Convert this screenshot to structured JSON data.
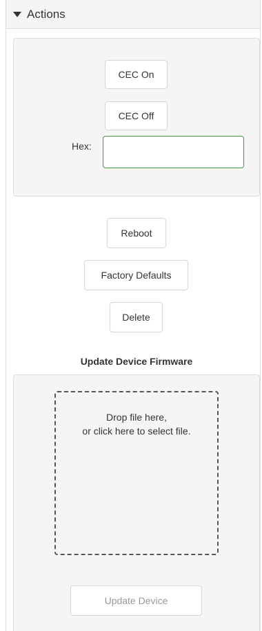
{
  "section": {
    "title": "Actions",
    "toggle_icon": "caret-down-icon"
  },
  "cec": {
    "on_label": "CEC On",
    "off_label": "CEC Off",
    "hex_label": "Hex:",
    "hex_value": "",
    "hex_placeholder": ""
  },
  "device_actions": {
    "reboot_label": "Reboot",
    "factory_defaults_label": "Factory Defaults",
    "delete_label": "Delete"
  },
  "firmware": {
    "title": "Update Device Firmware",
    "dropzone_line1": "Drop file here,",
    "dropzone_line2": "or click here to select file.",
    "update_button_label": "Update Device",
    "update_button_disabled": true
  },
  "colors": {
    "panel_bg": "#f5f5f5",
    "input_focus_border": "#3c9a3c",
    "disabled_text": "#999999"
  }
}
